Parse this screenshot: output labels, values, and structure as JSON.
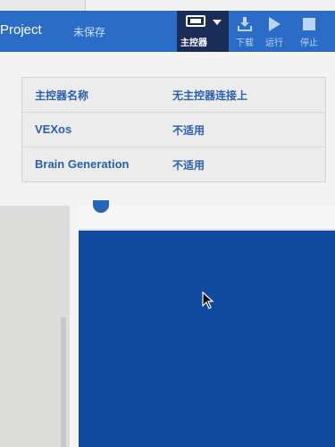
{
  "toolbar": {
    "project_label": "Project",
    "unsaved_label": "未保存",
    "brain_label": "主控器",
    "download_label": "下载",
    "run_label": "运行",
    "stop_label": "停止"
  },
  "brain_info": {
    "rows": [
      {
        "key": "主控器名称",
        "value": "无主控器连接上"
      },
      {
        "key": "VEXos",
        "value": "不适用"
      },
      {
        "key": "Brain Generation",
        "value": "不适用"
      }
    ]
  },
  "colors": {
    "toolbar_blue": "#2a6cc6",
    "brain_button_dark": "#1a2d57",
    "text_blue": "#2a5fb0",
    "workspace_blue": "#0f4a9e"
  },
  "icons": [
    "brain-icon",
    "caret-down-icon",
    "download-icon",
    "play-icon",
    "stop-icon",
    "mouse-cursor-icon"
  ]
}
